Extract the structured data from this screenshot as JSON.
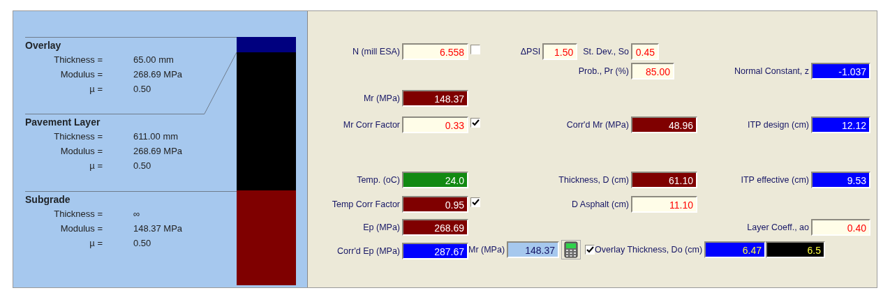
{
  "layers": [
    {
      "name": "Overlay",
      "color": "#00007f",
      "props": [
        {
          "label": "Thickness =",
          "value": "65.00 mm"
        },
        {
          "label": "Modulus =",
          "value": "268.69 MPa"
        },
        {
          "label": "µ =",
          "value": "0.50"
        }
      ]
    },
    {
      "name": "Pavement Layer",
      "color": "#000000",
      "props": [
        {
          "label": "Thickness =",
          "value": "611.00 mm"
        },
        {
          "label": "Modulus =",
          "value": "268.69 MPa"
        },
        {
          "label": "µ =",
          "value": "0.50"
        }
      ]
    },
    {
      "name": "Subgrade",
      "color": "#7f0000",
      "props": [
        {
          "label": "Thickness =",
          "value": "∞"
        },
        {
          "label": "Modulus =",
          "value": "148.37 MPa"
        },
        {
          "label": "µ =",
          "value": "0.50"
        }
      ]
    }
  ],
  "rows": [
    {
      "left": {
        "label": "N (mill ESA)",
        "value": "6.558",
        "kind": "input",
        "checked": false
      },
      "middle": [
        {
          "label": "ΔPSI",
          "value": "1.50",
          "kind": "input"
        },
        {
          "label": "St. Dev., So",
          "value": "0.45",
          "kind": "input"
        }
      ]
    },
    {
      "middle": [
        {
          "label": "Prob., Pr (%)",
          "value": "85.00",
          "kind": "input"
        }
      ],
      "right": {
        "label": "Normal Constant, z",
        "value": "-1.037",
        "kind": "output"
      }
    },
    {
      "left": {
        "label": "Mr (MPa)",
        "value": "148.37",
        "kind": "result"
      }
    },
    {
      "left": {
        "label": "Mr Corr Factor",
        "value": "0.33",
        "kind": "input",
        "checked": true
      },
      "middle": [
        {
          "label": "Corr'd Mr (MPa)",
          "value": "48.96",
          "kind": "result"
        }
      ],
      "right": {
        "label": "ITP design (cm)",
        "value": "12.12",
        "kind": "output"
      }
    },
    {
      "left": {
        "label": "Temp. (oC)",
        "value": "24.0",
        "kind": "temp"
      },
      "middle": [
        {
          "label": "Thickness, D (cm)",
          "value": "61.10",
          "kind": "result"
        }
      ],
      "right": {
        "label": "ITP effective (cm)",
        "value": "9.53",
        "kind": "output"
      }
    },
    {
      "left": {
        "label": "Temp Corr Factor",
        "value": "0.95",
        "kind": "result",
        "checked": true
      },
      "middle": [
        {
          "label": "D Asphalt (cm)",
          "value": "11.10",
          "kind": "input"
        }
      ]
    },
    {
      "left": {
        "label": "Ep (MPa)",
        "value": "268.69",
        "kind": "result"
      },
      "right": {
        "label": "Layer Coeff., ao",
        "value": "0.40",
        "kind": "input"
      }
    },
    {
      "left": {
        "label": "Corr'd Ep (MPa)",
        "value": "287.67",
        "kind": "output"
      },
      "tail": {
        "mr": {
          "label": "Mr (MPa)",
          "value": "148.37",
          "kind": "display"
        },
        "overlay": {
          "label": "Overlay Thickness, Do (cm)",
          "checked": true,
          "value": "6.47",
          "kind": "design",
          "rounded": {
            "value": "6.5",
            "kind": "final"
          }
        }
      }
    }
  ]
}
